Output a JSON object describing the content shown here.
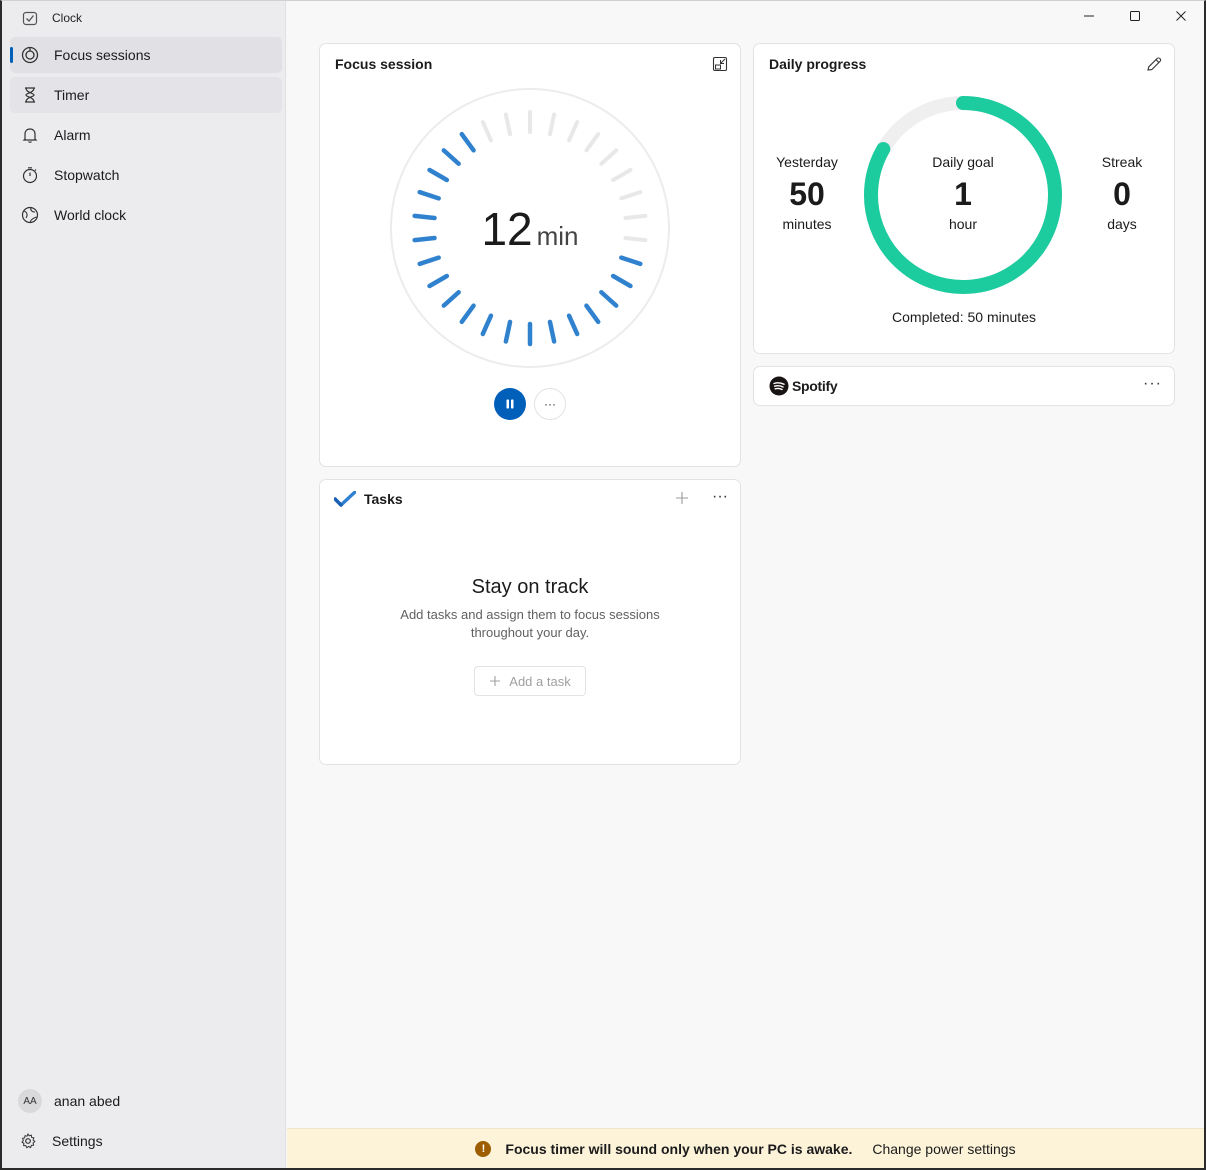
{
  "app": {
    "title": "Clock"
  },
  "sidebar": {
    "items": [
      {
        "label": "Focus sessions",
        "icon": "focus-icon"
      },
      {
        "label": "Timer",
        "icon": "hourglass-icon"
      },
      {
        "label": "Alarm",
        "icon": "bell-icon"
      },
      {
        "label": "Stopwatch",
        "icon": "stopwatch-icon"
      },
      {
        "label": "World clock",
        "icon": "globe-icon"
      }
    ],
    "user": {
      "initials": "AA",
      "name": "anan abed"
    },
    "settings_label": "Settings"
  },
  "focus_session": {
    "title": "Focus session",
    "remaining_value": "12",
    "remaining_unit": "min",
    "progress_fraction": 0.6,
    "more_label": "···"
  },
  "daily_progress": {
    "title": "Daily progress",
    "yesterday": {
      "label": "Yesterday",
      "value": "50",
      "unit": "minutes"
    },
    "daily_goal": {
      "label": "Daily goal",
      "value": "1",
      "unit": "hour"
    },
    "streak": {
      "label": "Streak",
      "value": "0",
      "unit": "days"
    },
    "completed_text": "Completed: 50 minutes",
    "completed_fraction": 0.8333
  },
  "spotify": {
    "name": "Spotify",
    "more_label": "···"
  },
  "tasks": {
    "title": "Tasks",
    "more_label": "···",
    "empty_title": "Stay on track",
    "empty_desc": "Add tasks and assign them to focus sessions throughout your day.",
    "add_label": "Add a task"
  },
  "banner": {
    "message": "Focus timer will sound only when your PC is awake.",
    "link": "Change power settings"
  },
  "colors": {
    "accent": "#005fb8",
    "progress_ring": "#1ccb9e",
    "dial_active": "#3182ce",
    "dial_inactive": "#e8e8e8"
  }
}
